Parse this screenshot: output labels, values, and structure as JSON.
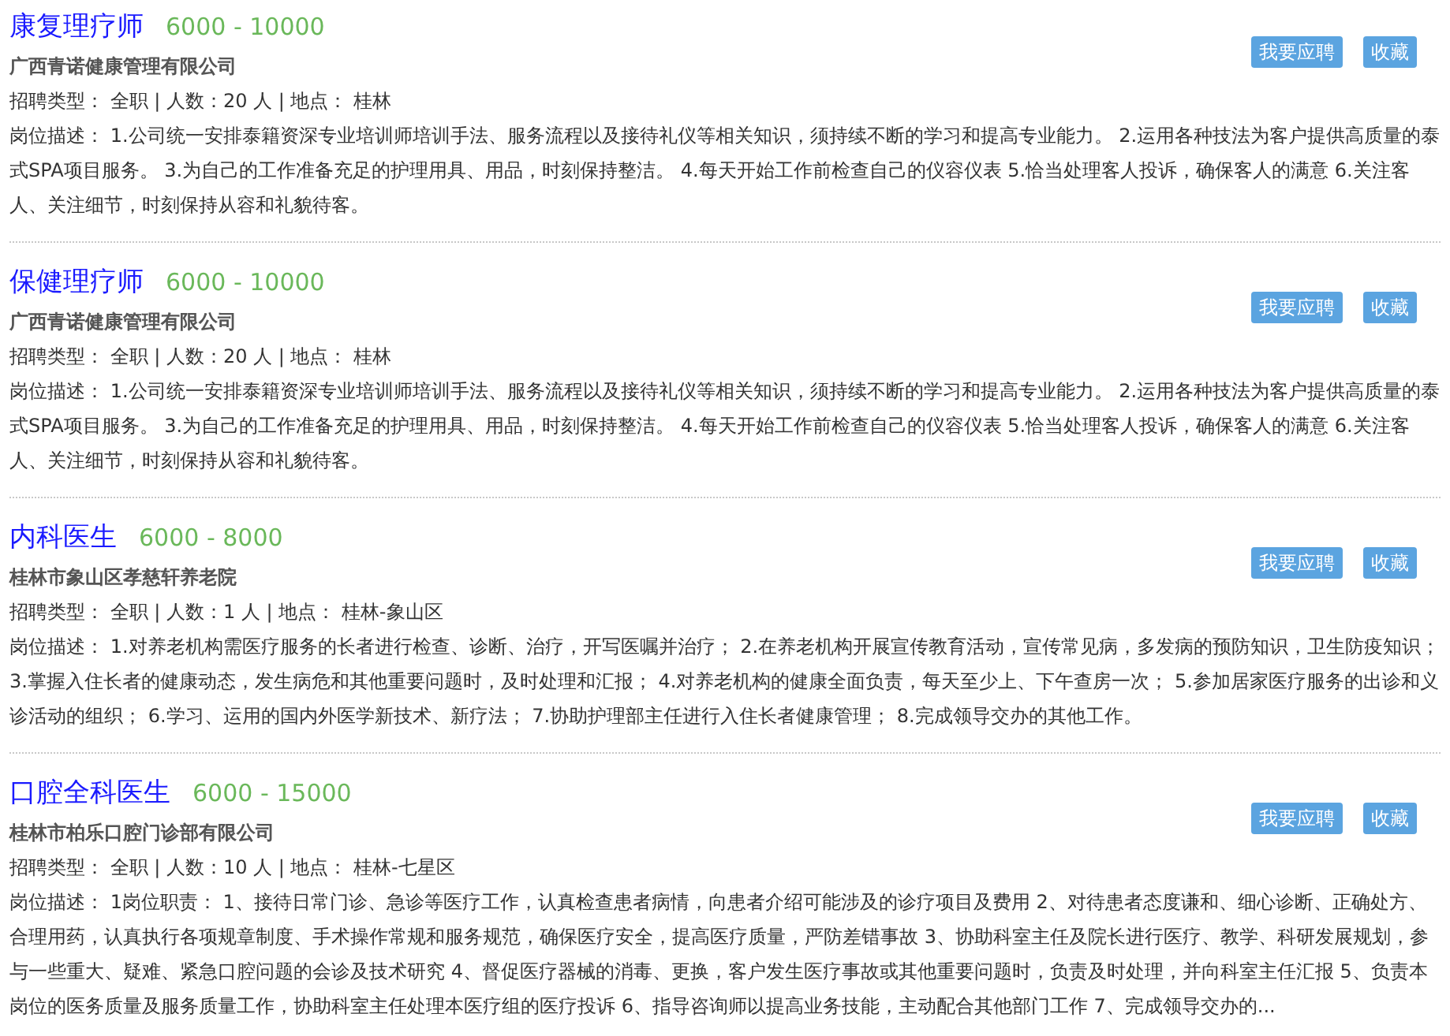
{
  "jobs": [
    {
      "title": "康复理疗师",
      "salary": "6000 - 10000",
      "company": "广西青诺健康管理有限公司",
      "meta": "招聘类型： 全职 | 人数：20 人 | 地点： 桂林",
      "description": "岗位描述： 1.公司统一安排泰籍资深专业培训师培训手法、服务流程以及接待礼仪等相关知识，须持续不断的学习和提高专业能力。 2.运用各种技法为客户提供高质量的泰式SPA项目服务。 3.为自己的工作准备充足的护理用具、用品，时刻保持整洁。 4.每天开始工作前检查自己的仪容仪表 5.恰当处理客人投诉，确保客人的满意 6.关注客人、关注细节，时刻保持从容和礼貌待客。",
      "apply": "我要应聘",
      "save": "收藏"
    },
    {
      "title": "保健理疗师",
      "salary": "6000 - 10000",
      "company": "广西青诺健康管理有限公司",
      "meta": "招聘类型： 全职 | 人数：20 人 | 地点： 桂林",
      "description": "岗位描述： 1.公司统一安排泰籍资深专业培训师培训手法、服务流程以及接待礼仪等相关知识，须持续不断的学习和提高专业能力。 2.运用各种技法为客户提供高质量的泰式SPA项目服务。 3.为自己的工作准备充足的护理用具、用品，时刻保持整洁。 4.每天开始工作前检查自己的仪容仪表 5.恰当处理客人投诉，确保客人的满意 6.关注客人、关注细节，时刻保持从容和礼貌待客。",
      "apply": "我要应聘",
      "save": "收藏"
    },
    {
      "title": "内科医生",
      "salary": "6000 - 8000",
      "company": "桂林市象山区孝慈轩养老院",
      "meta": "招聘类型： 全职 | 人数：1 人 | 地点： 桂林-象山区",
      "description": "岗位描述： 1.对养老机构需医疗服务的长者进行检查、诊断、治疗，开写医嘱并治疗； 2.在养老机构开展宣传教育活动，宣传常见病，多发病的预防知识，卫生防疫知识； 3.掌握入住长者的健康动态，发生病危和其他重要问题时，及时处理和汇报； 4.对养老机构的健康全面负责，每天至少上、下午查房一次； 5.参加居家医疗服务的出诊和义诊活动的组织； 6.学习、运用的国内外医学新技术、新疗法； 7.协助护理部主任进行入住长者健康管理； 8.完成领导交办的其他工作。",
      "apply": "我要应聘",
      "save": "收藏"
    },
    {
      "title": "口腔全科医生",
      "salary": "6000 - 15000",
      "company": "桂林市柏乐口腔门诊部有限公司",
      "meta": "招聘类型： 全职 | 人数：10 人 | 地点： 桂林-七星区",
      "description": "岗位描述： 1岗位职责： 1、接待日常门诊、急诊等医疗工作，认真检查患者病情，向患者介绍可能涉及的诊疗项目及费用 2、对待患者态度谦和、细心诊断、正确处方、合理用药，认真执行各项规章制度、手术操作常规和服务规范，确保医疗安全，提高医疗质量，严防差错事故 3、协助科室主任及院长进行医疗、教学、科研发展规划，参与一些重大、疑难、紧急口腔问题的会诊及技术研究 4、督促医疗器械的消毒、更换，客户发生医疗事故或其他重要问题时，负责及时处理，并向科室主任汇报 5、负责本岗位的医务质量及服务质量工作，协助科室主任处理本医疗组的医疗投诉 6、指导咨询师以提高业务技能，主动配合其他部门工作 7、完成领导交办的...",
      "apply": "我要应聘",
      "save": "收藏"
    }
  ]
}
